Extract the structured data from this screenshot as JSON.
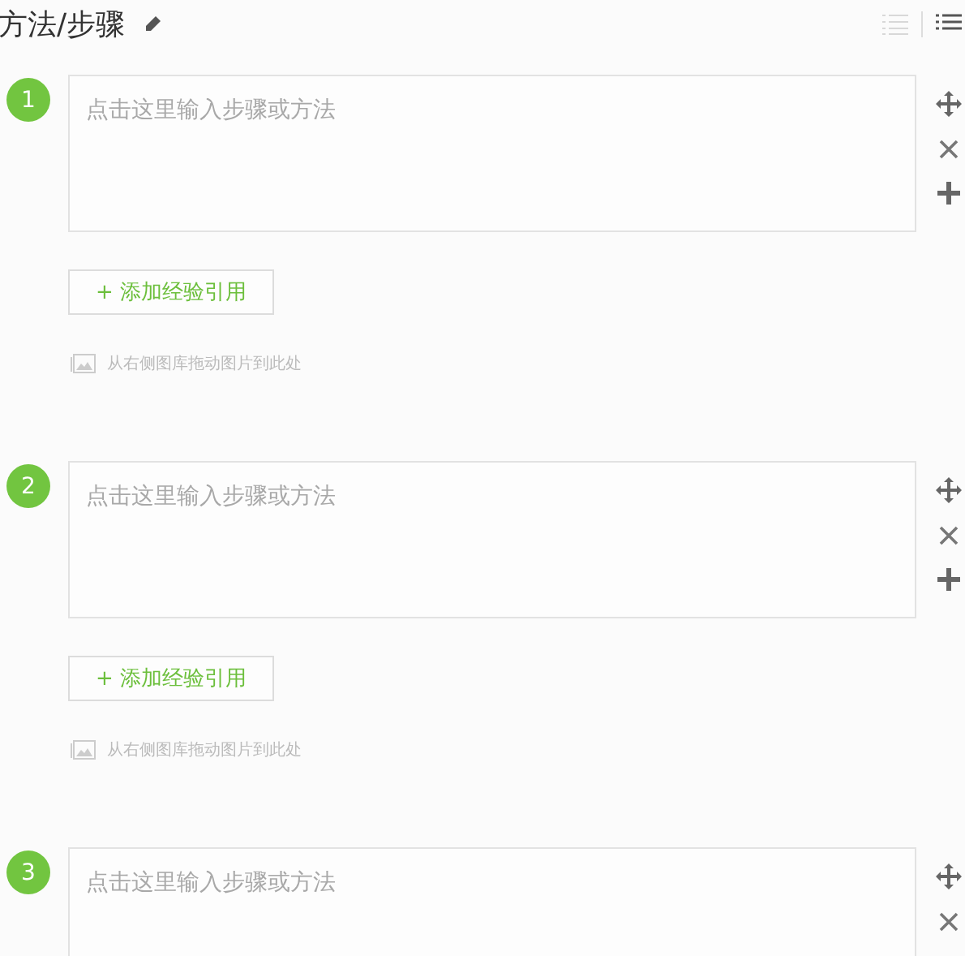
{
  "header": {
    "title": "方法/步骤"
  },
  "view_modes": [
    {
      "kind": "plain",
      "selected": false
    },
    {
      "kind": "list",
      "selected": true
    }
  ],
  "steps": [
    {
      "number": "1",
      "placeholder": "点击这里输入步骤或方法",
      "actions": [
        {
          "kind": "move"
        },
        {
          "kind": "remove"
        },
        {
          "kind": "add"
        }
      ],
      "button": "+ 添加经验引用",
      "image_hint": "从右侧图库拖动图片到此处"
    },
    {
      "number": "2",
      "placeholder": "点击这里输入步骤或方法",
      "actions": [
        {
          "kind": "move"
        },
        {
          "kind": "remove"
        },
        {
          "kind": "add"
        }
      ],
      "button": "+ 添加经验引用",
      "image_hint": "从右侧图库拖动图片到此处"
    },
    {
      "number": "3",
      "placeholder": "点击这里输入步骤或方法",
      "actions": [
        {
          "kind": "move"
        },
        {
          "kind": "remove"
        }
      ]
    }
  ]
}
